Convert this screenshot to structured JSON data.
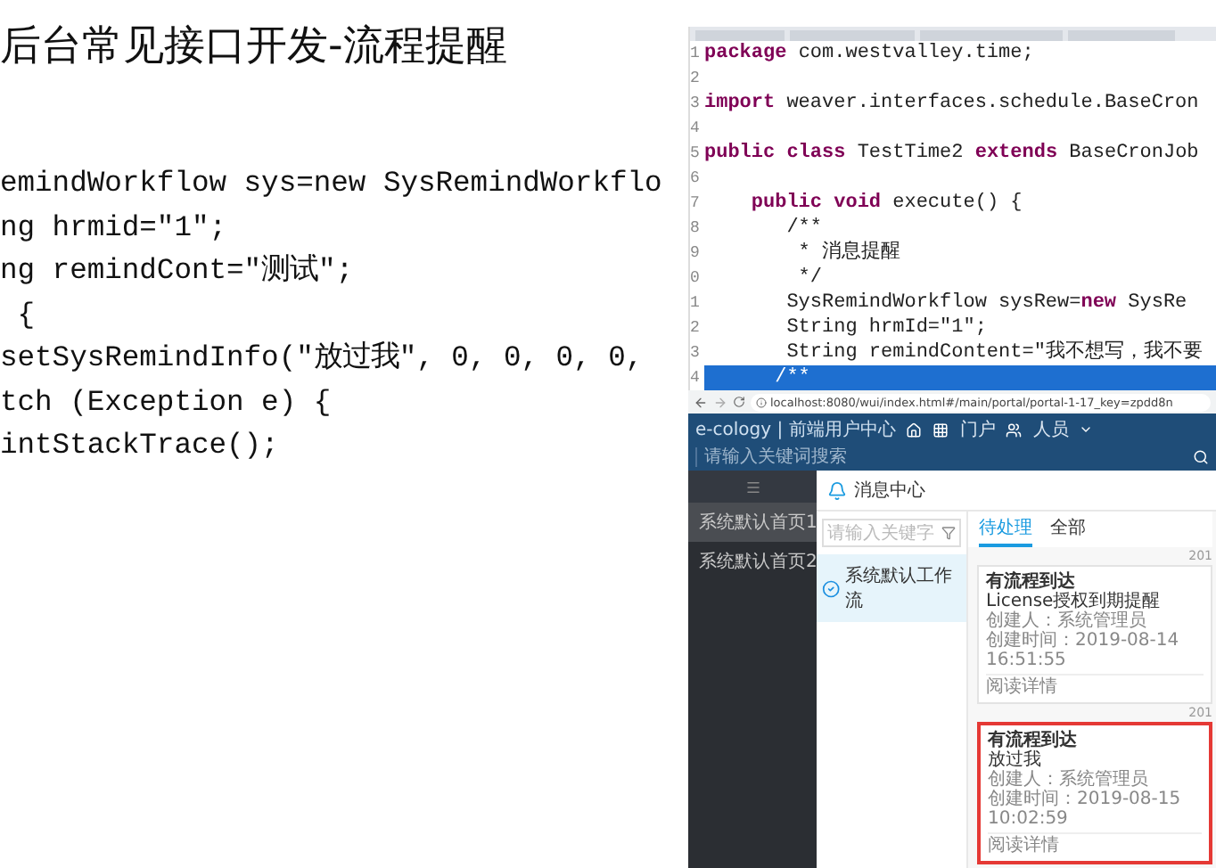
{
  "slide": {
    "title": "后台常见接口开发-流程提醒",
    "code_lines": [
      "emindWorkflow sys=new SysRemindWorkflo",
      "ng hrmid=\"1\";",
      "ng remindCont=\"测试\";",
      " {",
      "setSysRemindInfo(\"放过我\", 0, 0, 0, 0,",
      "tch (Exception e) {",
      "intStackTrace();"
    ]
  },
  "editor": {
    "lines": [
      {
        "number": "1",
        "text": "**package** com.westvalley.time;",
        "selected": false
      },
      {
        "number": "2",
        "selected": false
      },
      {
        "number": "3",
        "text": "**import** weaver.interfaces.schedule.BaseCron",
        "selected": false
      },
      {
        "number": "4",
        "selected": false
      },
      {
        "number": "5",
        "text": "**public class** TestTime2 **extends** BaseCronJob",
        "selected": false
      },
      {
        "number": "6",
        "selected": false
      },
      {
        "number": "7",
        "text": "    **public void** execute() {",
        "selected": false
      },
      {
        "number": "8",
        "text": "       /**",
        "selected": false
      },
      {
        "number": "9",
        "text": "        * 消息提醒",
        "selected": false
      },
      {
        "number": "0",
        "text": "        */",
        "selected": false
      },
      {
        "number": "1",
        "text": "       SysRemindWorkflow sysRew=**new** SysRe",
        "selected": false
      },
      {
        "number": "2",
        "text": "       String hrmId=\"1\";",
        "selected": false
      },
      {
        "number": "3",
        "text": "       String remindContent=\"我不想写，我不要",
        "selected": false
      },
      {
        "number": "4",
        "text": "      /**",
        "selected": true
      }
    ]
  },
  "browser": {
    "url": "localhost:8080/wui/index.html#/main/portal/portal-1-17_key=zpdd8n"
  },
  "app": {
    "brand": "e-cology | 前端用户中心",
    "portal": "门户",
    "people": "人员",
    "search_placeholder": "请输入关键词搜索",
    "sidebar": [
      {
        "label": "系统默认首页1",
        "selected": true
      },
      {
        "label": "系统默认首页2",
        "selected": false
      }
    ],
    "panel_title": "消息中心",
    "list_search_placeholder": "请输入关键字",
    "workflows": [
      {
        "label": "系统默认工作流",
        "selected": true
      }
    ],
    "tabs": [
      {
        "label": "待处理",
        "selected": true
      },
      {
        "label": "全部",
        "selected": false
      }
    ],
    "messages": [
      {
        "date": "201",
        "title": "有流程到达",
        "body": "License授权到期提醒",
        "creator": "创建人：系统管理员",
        "created": "创建时间：2019-08-14 16:51:55",
        "link": "阅读详情",
        "highlighted": false
      },
      {
        "date": "201",
        "title": "有流程到达",
        "body": "放过我",
        "creator": "创建人：系统管理员",
        "created": "创建时间：2019-08-15 10:02:59",
        "link": "阅读详情",
        "highlighted": true
      }
    ]
  }
}
